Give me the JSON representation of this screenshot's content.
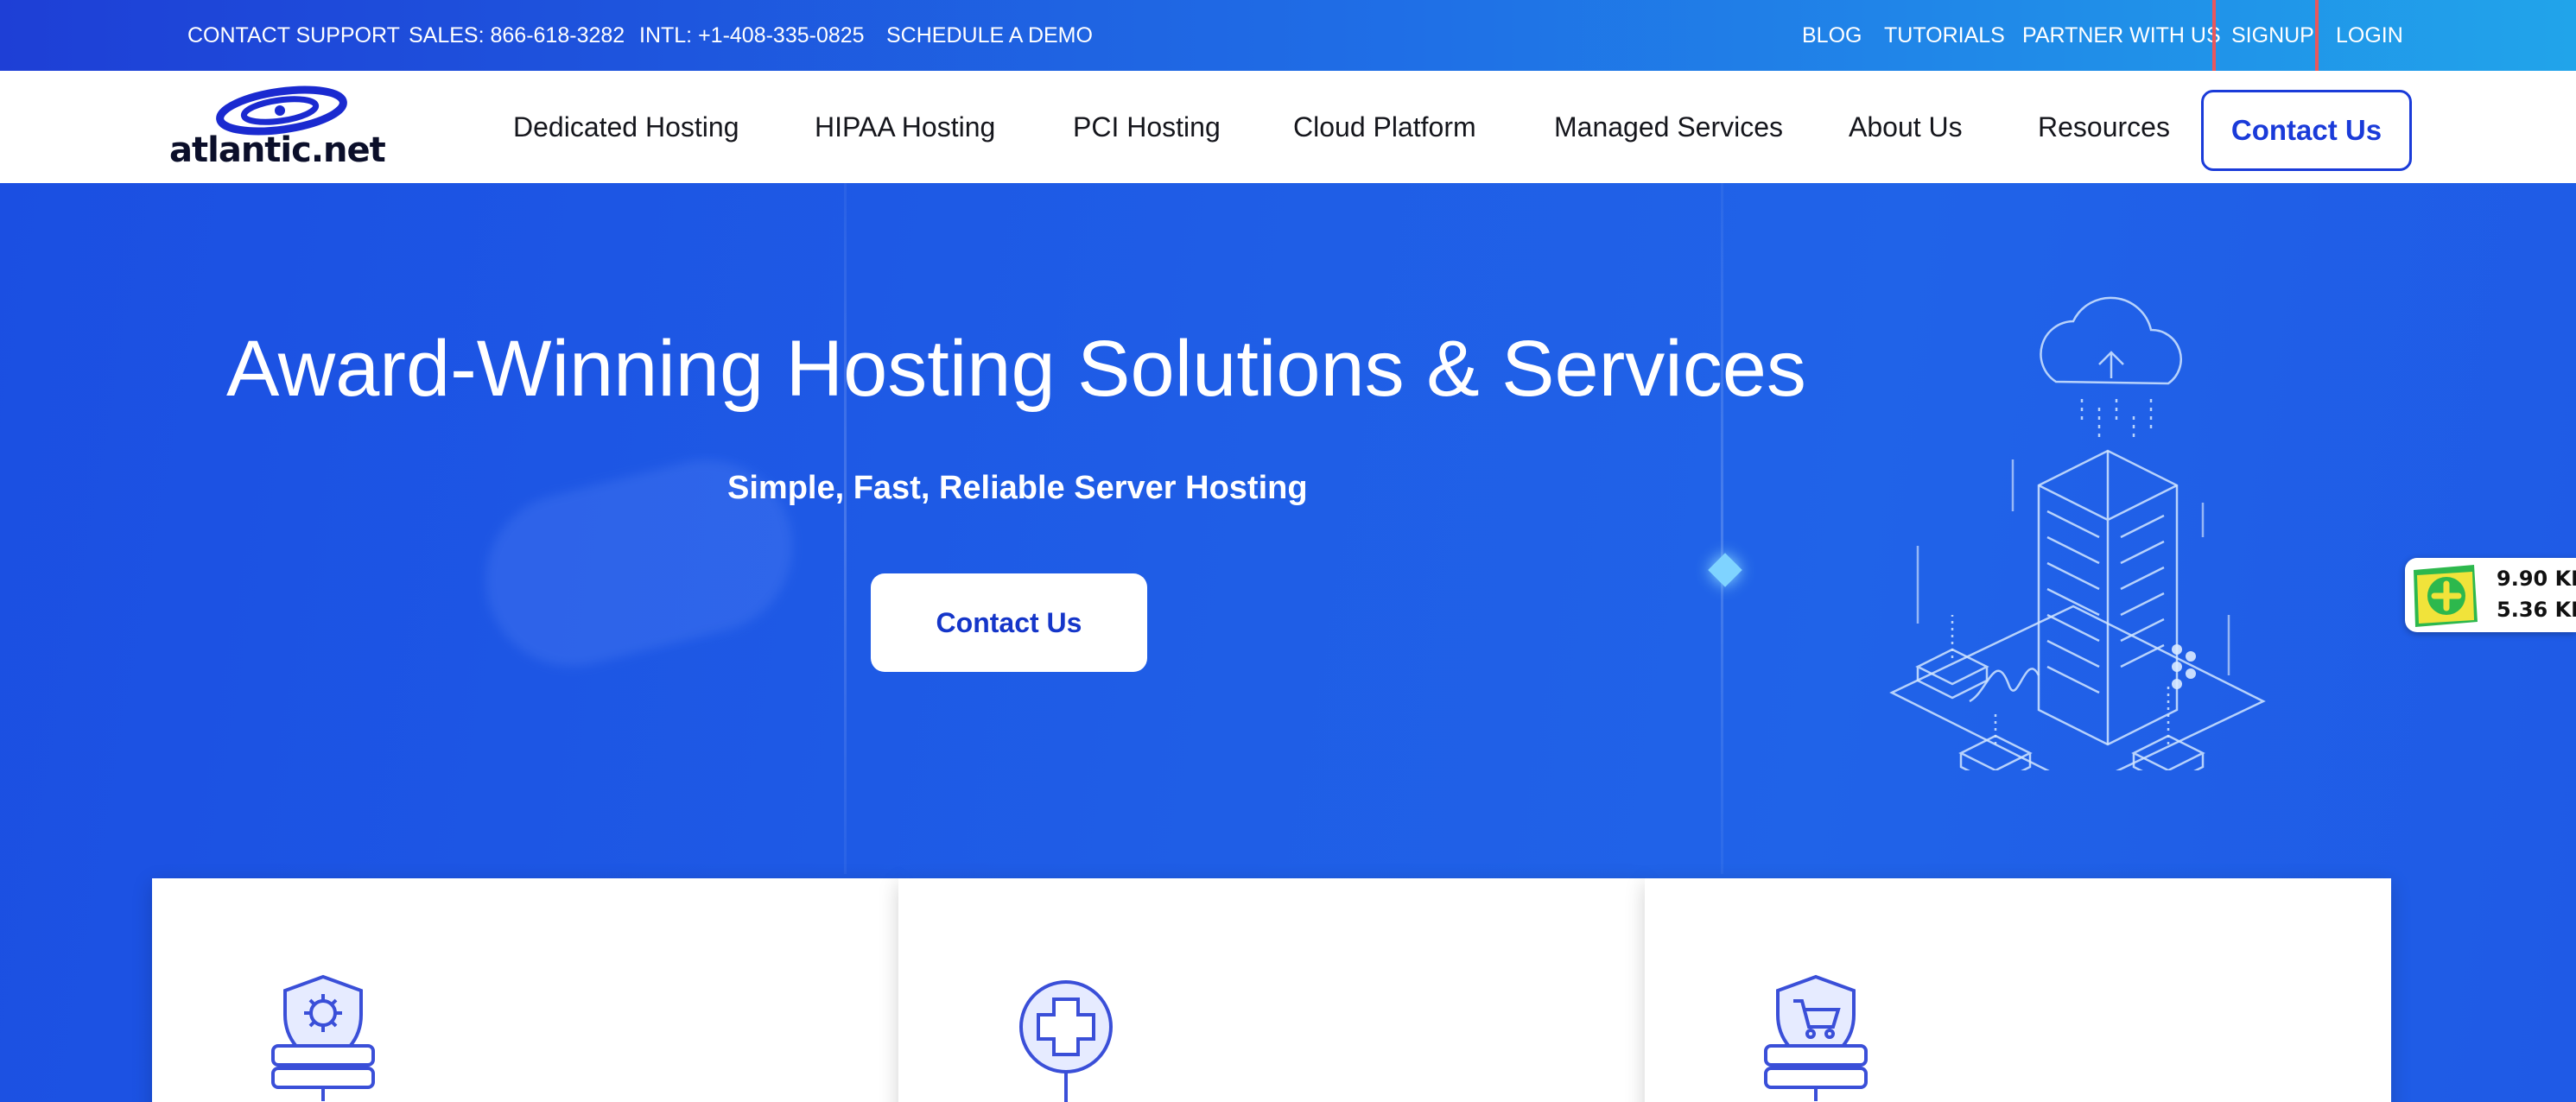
{
  "topbar": {
    "left_links": [
      {
        "label": "CONTACT SUPPORT"
      },
      {
        "label": "SALES: 866-618-3282"
      },
      {
        "label": "INTL: +1-408-335-0825"
      },
      {
        "label": "SCHEDULE A DEMO"
      }
    ],
    "right_links": [
      {
        "label": "BLOG"
      },
      {
        "label": "TUTORIALS"
      },
      {
        "label": "PARTNER WITH US"
      },
      {
        "label": "SIGNUP"
      },
      {
        "label": "LOGIN"
      }
    ],
    "highlight_color": "#e8575c"
  },
  "nav": {
    "logo_text": "atlantic.net",
    "items": [
      {
        "label": "Dedicated Hosting"
      },
      {
        "label": "HIPAA Hosting"
      },
      {
        "label": "PCI Hosting"
      },
      {
        "label": "Cloud Platform"
      },
      {
        "label": "Managed Services"
      },
      {
        "label": "About Us"
      },
      {
        "label": "Resources"
      }
    ],
    "contact_label": "Contact Us"
  },
  "hero": {
    "title": "Award-Winning Hosting Solutions & Services",
    "subtitle": "Simple, Fast, Reliable Server Hosting",
    "cta_label": "Contact Us"
  },
  "cards": [
    {
      "icon": "server-shield-gear-icon"
    },
    {
      "icon": "medical-cross-icon"
    },
    {
      "icon": "server-shield-cart-icon"
    }
  ],
  "widget": {
    "line1": "9.90 KB",
    "line2": "5.36 KB"
  },
  "colors": {
    "brand_blue": "#1a3bd9",
    "hero_blue": "#1f5ae6",
    "topbar_start": "#1e3fd6",
    "topbar_end": "#21a4ea"
  }
}
